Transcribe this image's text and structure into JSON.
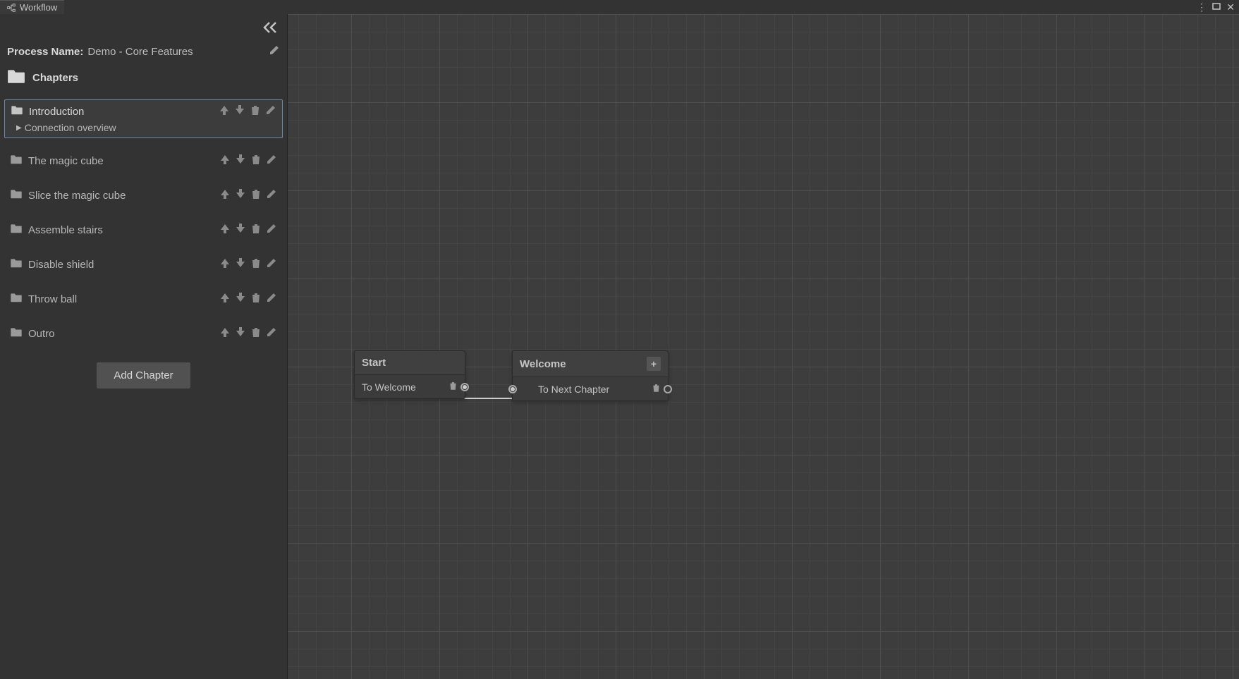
{
  "window": {
    "title": "Workflow"
  },
  "sidebar": {
    "process_label": "Process Name:",
    "process_name": "Demo - Core Features",
    "chapters_label": "Chapters",
    "add_chapter_label": "Add Chapter",
    "items": [
      {
        "name": "Introduction",
        "sub": "Connection overview",
        "selected": true
      },
      {
        "name": "The magic cube"
      },
      {
        "name": "Slice the magic cube"
      },
      {
        "name": "Assemble stairs"
      },
      {
        "name": "Disable shield"
      },
      {
        "name": "Throw ball"
      },
      {
        "name": "Outro"
      }
    ]
  },
  "nodes": {
    "start": {
      "title": "Start",
      "out_label": "To Welcome"
    },
    "welcome": {
      "title": "Welcome",
      "out_label": "To Next Chapter",
      "add": "+"
    }
  }
}
